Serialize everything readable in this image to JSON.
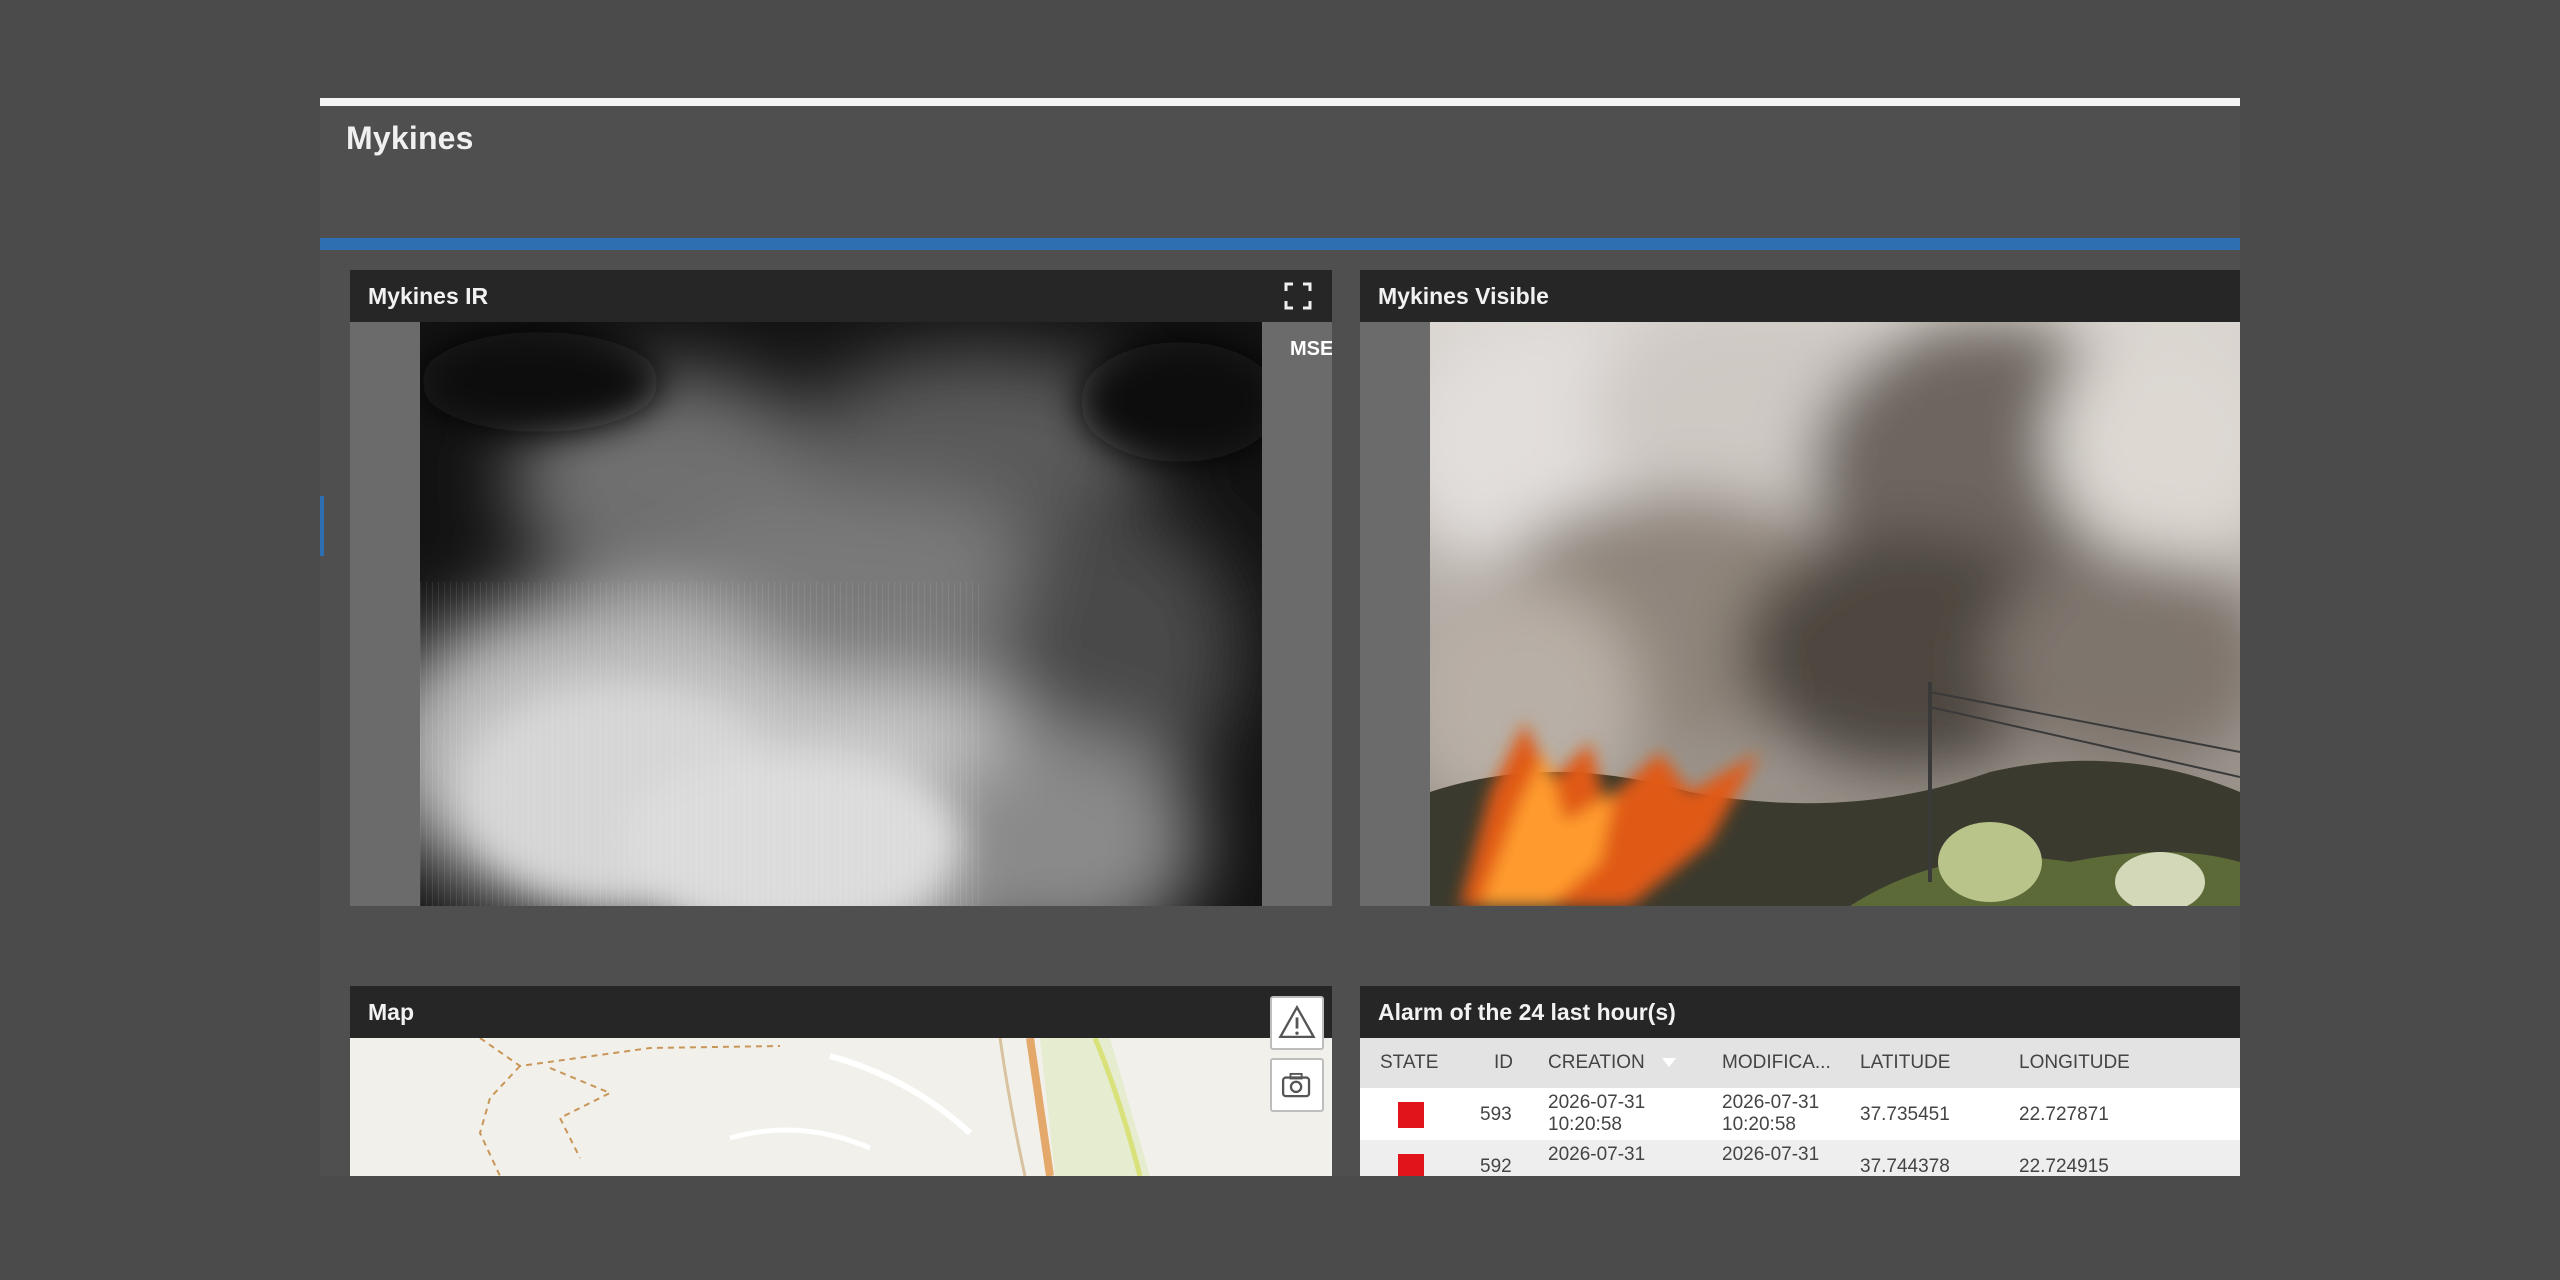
{
  "app": {
    "title": "Mykines"
  },
  "panels": {
    "ir": {
      "title": "Mykines IR",
      "overlay_label": "MSE",
      "fullscreen_icon": "fullscreen-icon"
    },
    "visible": {
      "title": "Mykines Visible"
    },
    "map": {
      "title": "Map",
      "tools": [
        "alert-triangle-icon",
        "camera-icon"
      ]
    },
    "alarms": {
      "title": "Alarm of the 24 last hour(s)",
      "columns": [
        "STATE",
        "ID",
        "CREATION",
        "MODIFICA...",
        "LATITUDE",
        "LONGITUDE"
      ],
      "sort_column": "CREATION",
      "rows": [
        {
          "state_color": "#e2141b",
          "id": "593",
          "creation_date": "2026-07-31",
          "creation_time": "10:20:58",
          "modification_date": "2026-07-31",
          "modification_time": "10:20:58",
          "latitude": "37.735451",
          "longitude": "22.727871"
        },
        {
          "state_color": "#e2141b",
          "id": "592",
          "creation_date": "2026-07-31",
          "creation_time": "",
          "modification_date": "2026-07-31",
          "modification_time": "",
          "latitude": "37.744378",
          "longitude": "22.724915"
        }
      ]
    }
  },
  "colors": {
    "accent_blue": "#2d6fb0",
    "alarm_red": "#e2141b",
    "panel_header": "#262626"
  }
}
